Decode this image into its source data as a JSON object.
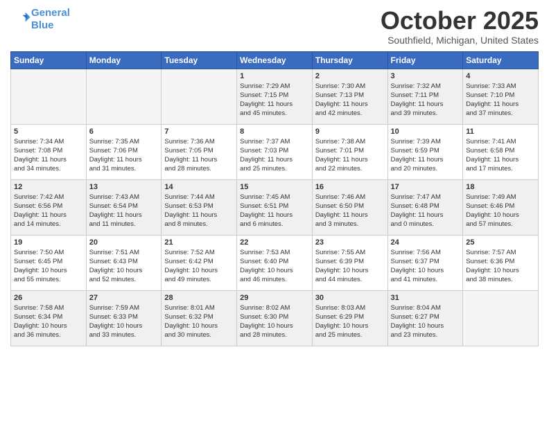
{
  "header": {
    "logo_line1": "General",
    "logo_line2": "Blue",
    "month": "October 2025",
    "location": "Southfield, Michigan, United States"
  },
  "weekdays": [
    "Sunday",
    "Monday",
    "Tuesday",
    "Wednesday",
    "Thursday",
    "Friday",
    "Saturday"
  ],
  "weeks": [
    [
      {
        "day": "",
        "info": "",
        "empty": true
      },
      {
        "day": "",
        "info": "",
        "empty": true
      },
      {
        "day": "",
        "info": "",
        "empty": true
      },
      {
        "day": "1",
        "info": "Sunrise: 7:29 AM\nSunset: 7:15 PM\nDaylight: 11 hours\nand 45 minutes.",
        "empty": false
      },
      {
        "day": "2",
        "info": "Sunrise: 7:30 AM\nSunset: 7:13 PM\nDaylight: 11 hours\nand 42 minutes.",
        "empty": false
      },
      {
        "day": "3",
        "info": "Sunrise: 7:32 AM\nSunset: 7:11 PM\nDaylight: 11 hours\nand 39 minutes.",
        "empty": false
      },
      {
        "day": "4",
        "info": "Sunrise: 7:33 AM\nSunset: 7:10 PM\nDaylight: 11 hours\nand 37 minutes.",
        "empty": false
      }
    ],
    [
      {
        "day": "5",
        "info": "Sunrise: 7:34 AM\nSunset: 7:08 PM\nDaylight: 11 hours\nand 34 minutes.",
        "empty": false
      },
      {
        "day": "6",
        "info": "Sunrise: 7:35 AM\nSunset: 7:06 PM\nDaylight: 11 hours\nand 31 minutes.",
        "empty": false
      },
      {
        "day": "7",
        "info": "Sunrise: 7:36 AM\nSunset: 7:05 PM\nDaylight: 11 hours\nand 28 minutes.",
        "empty": false
      },
      {
        "day": "8",
        "info": "Sunrise: 7:37 AM\nSunset: 7:03 PM\nDaylight: 11 hours\nand 25 minutes.",
        "empty": false
      },
      {
        "day": "9",
        "info": "Sunrise: 7:38 AM\nSunset: 7:01 PM\nDaylight: 11 hours\nand 22 minutes.",
        "empty": false
      },
      {
        "day": "10",
        "info": "Sunrise: 7:39 AM\nSunset: 6:59 PM\nDaylight: 11 hours\nand 20 minutes.",
        "empty": false
      },
      {
        "day": "11",
        "info": "Sunrise: 7:41 AM\nSunset: 6:58 PM\nDaylight: 11 hours\nand 17 minutes.",
        "empty": false
      }
    ],
    [
      {
        "day": "12",
        "info": "Sunrise: 7:42 AM\nSunset: 6:56 PM\nDaylight: 11 hours\nand 14 minutes.",
        "empty": false
      },
      {
        "day": "13",
        "info": "Sunrise: 7:43 AM\nSunset: 6:54 PM\nDaylight: 11 hours\nand 11 minutes.",
        "empty": false
      },
      {
        "day": "14",
        "info": "Sunrise: 7:44 AM\nSunset: 6:53 PM\nDaylight: 11 hours\nand 8 minutes.",
        "empty": false
      },
      {
        "day": "15",
        "info": "Sunrise: 7:45 AM\nSunset: 6:51 PM\nDaylight: 11 hours\nand 6 minutes.",
        "empty": false
      },
      {
        "day": "16",
        "info": "Sunrise: 7:46 AM\nSunset: 6:50 PM\nDaylight: 11 hours\nand 3 minutes.",
        "empty": false
      },
      {
        "day": "17",
        "info": "Sunrise: 7:47 AM\nSunset: 6:48 PM\nDaylight: 11 hours\nand 0 minutes.",
        "empty": false
      },
      {
        "day": "18",
        "info": "Sunrise: 7:49 AM\nSunset: 6:46 PM\nDaylight: 10 hours\nand 57 minutes.",
        "empty": false
      }
    ],
    [
      {
        "day": "19",
        "info": "Sunrise: 7:50 AM\nSunset: 6:45 PM\nDaylight: 10 hours\nand 55 minutes.",
        "empty": false
      },
      {
        "day": "20",
        "info": "Sunrise: 7:51 AM\nSunset: 6:43 PM\nDaylight: 10 hours\nand 52 minutes.",
        "empty": false
      },
      {
        "day": "21",
        "info": "Sunrise: 7:52 AM\nSunset: 6:42 PM\nDaylight: 10 hours\nand 49 minutes.",
        "empty": false
      },
      {
        "day": "22",
        "info": "Sunrise: 7:53 AM\nSunset: 6:40 PM\nDaylight: 10 hours\nand 46 minutes.",
        "empty": false
      },
      {
        "day": "23",
        "info": "Sunrise: 7:55 AM\nSunset: 6:39 PM\nDaylight: 10 hours\nand 44 minutes.",
        "empty": false
      },
      {
        "day": "24",
        "info": "Sunrise: 7:56 AM\nSunset: 6:37 PM\nDaylight: 10 hours\nand 41 minutes.",
        "empty": false
      },
      {
        "day": "25",
        "info": "Sunrise: 7:57 AM\nSunset: 6:36 PM\nDaylight: 10 hours\nand 38 minutes.",
        "empty": false
      }
    ],
    [
      {
        "day": "26",
        "info": "Sunrise: 7:58 AM\nSunset: 6:34 PM\nDaylight: 10 hours\nand 36 minutes.",
        "empty": false
      },
      {
        "day": "27",
        "info": "Sunrise: 7:59 AM\nSunset: 6:33 PM\nDaylight: 10 hours\nand 33 minutes.",
        "empty": false
      },
      {
        "day": "28",
        "info": "Sunrise: 8:01 AM\nSunset: 6:32 PM\nDaylight: 10 hours\nand 30 minutes.",
        "empty": false
      },
      {
        "day": "29",
        "info": "Sunrise: 8:02 AM\nSunset: 6:30 PM\nDaylight: 10 hours\nand 28 minutes.",
        "empty": false
      },
      {
        "day": "30",
        "info": "Sunrise: 8:03 AM\nSunset: 6:29 PM\nDaylight: 10 hours\nand 25 minutes.",
        "empty": false
      },
      {
        "day": "31",
        "info": "Sunrise: 8:04 AM\nSunset: 6:27 PM\nDaylight: 10 hours\nand 23 minutes.",
        "empty": false
      },
      {
        "day": "",
        "info": "",
        "empty": true
      }
    ]
  ]
}
